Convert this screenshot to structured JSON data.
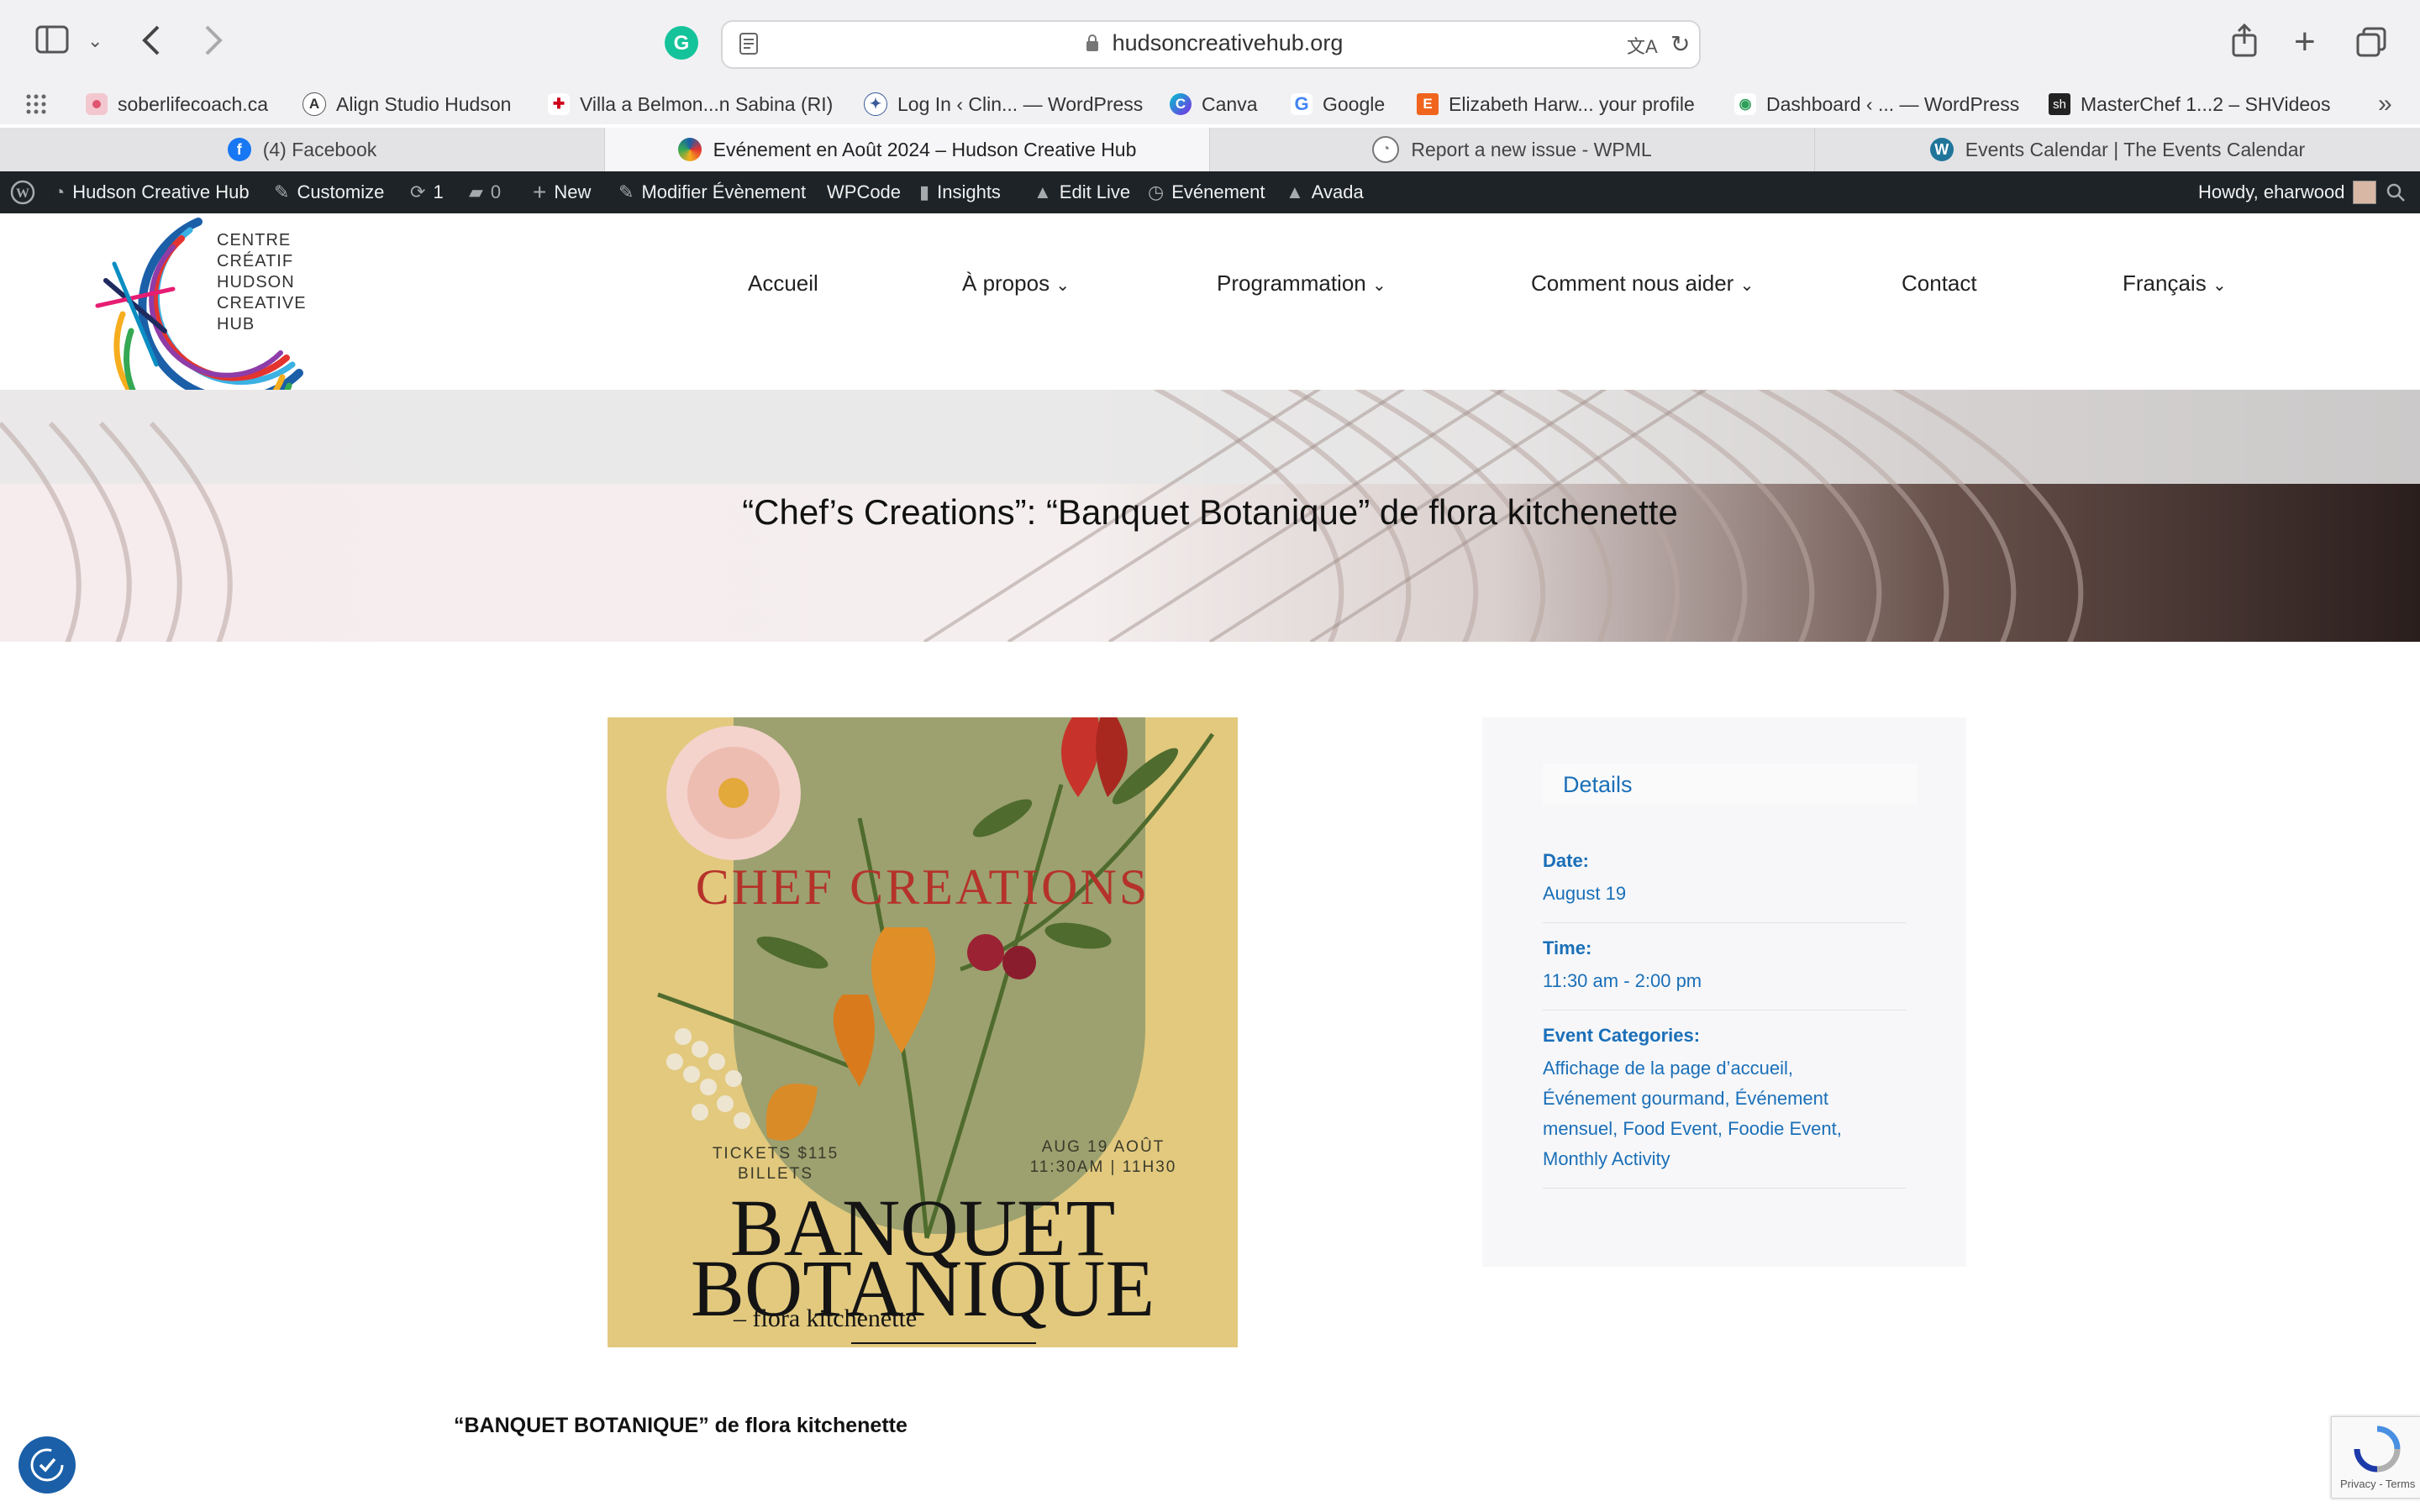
{
  "browser": {
    "url": "hudsoncreativehub.org",
    "bookmarks": [
      {
        "label": "soberlifecoach.ca",
        "icon": "bookmark-favicon-pink"
      },
      {
        "label": "Align Studio Hudson",
        "icon": "align-icon"
      },
      {
        "label": "Villa a Belmon...n Sabina (RI)",
        "icon": "villa-icon"
      },
      {
        "label": "Log In ‹ Clin... — WordPress",
        "icon": "clinic-icon"
      },
      {
        "label": "Canva",
        "icon": "canva-icon"
      },
      {
        "label": "Google",
        "icon": "google-icon"
      },
      {
        "label": "Elizabeth Harw... your profile",
        "icon": "etsy-icon"
      },
      {
        "label": "Dashboard ‹ ... — WordPress",
        "icon": "dashboard-icon"
      },
      {
        "label": "MasterChef 1...2 – SHVideos",
        "icon": "shvideos-icon"
      }
    ],
    "tabs": [
      {
        "label": "(4) Facebook",
        "icon": "facebook-icon",
        "active": false
      },
      {
        "label": "Evénement en Août 2024 – Hudson Creative Hub",
        "icon": "creative-hub-icon",
        "active": true
      },
      {
        "label": "Report a new issue - WPML",
        "icon": "wpml-icon",
        "active": false
      },
      {
        "label": "Events Calendar | The Events Calendar",
        "icon": "wordpress-icon",
        "active": false
      }
    ]
  },
  "wp_admin_bar": {
    "site_name": "Hudson Creative Hub",
    "customize": "Customize",
    "updates_count": "1",
    "comments_count": "0",
    "new": "New",
    "edit_event": "Modifier Évènement",
    "wpcode": "WPCode",
    "insights": "Insights",
    "edit_live": "Edit Live",
    "event": "Evénement",
    "avada": "Avada",
    "howdy": "Howdy, eharwood"
  },
  "site": {
    "logo_lines": [
      "CENTRE",
      "CRÉATIF",
      "HUDSON",
      "CREATIVE",
      "HUB"
    ],
    "nav": [
      {
        "label": "Accueil",
        "has_dropdown": false
      },
      {
        "label": "À propos",
        "has_dropdown": true
      },
      {
        "label": "Programmation",
        "has_dropdown": true
      },
      {
        "label": "Comment nous aider",
        "has_dropdown": true
      },
      {
        "label": "Contact",
        "has_dropdown": false
      },
      {
        "label": "Français",
        "has_dropdown": true
      }
    ]
  },
  "event": {
    "title": "“Chef’s Creations”: “Banquet Botanique” de flora kitchenette",
    "poster": {
      "heading": "CHEF CREATIONS",
      "tickets_line1": "TICKETS $115",
      "tickets_line2": "BILLETS",
      "date_line1": "AUG 19 AOÛT",
      "date_line2": "11:30AM | 11H30",
      "title_line1": "BANQUET",
      "title_line2": "BOTANIQUE",
      "subtitle": "– flora kitchenette"
    },
    "details": {
      "heading": "Details",
      "date_label": "Date:",
      "date_value": "August 19",
      "time_label": "Time:",
      "time_value": "11:30 am - 2:00 pm",
      "categories_label": "Event Categories:",
      "categories_lines": [
        "Affichage de la page d’accueil,",
        "Événement gourmand, Événement",
        "mensuel, Food Event, Foodie Event,",
        "Monthly Activity"
      ]
    },
    "body_heading": "“BANQUET BOTANIQUE” de flora kitchenette"
  },
  "recaptcha": {
    "terms": "Privacy - Terms"
  },
  "colors": {
    "link": "#1a6fb8",
    "wp_bar": "#1d2327",
    "poster_bg": "#e2c97e",
    "poster_red": "#b5322a"
  }
}
